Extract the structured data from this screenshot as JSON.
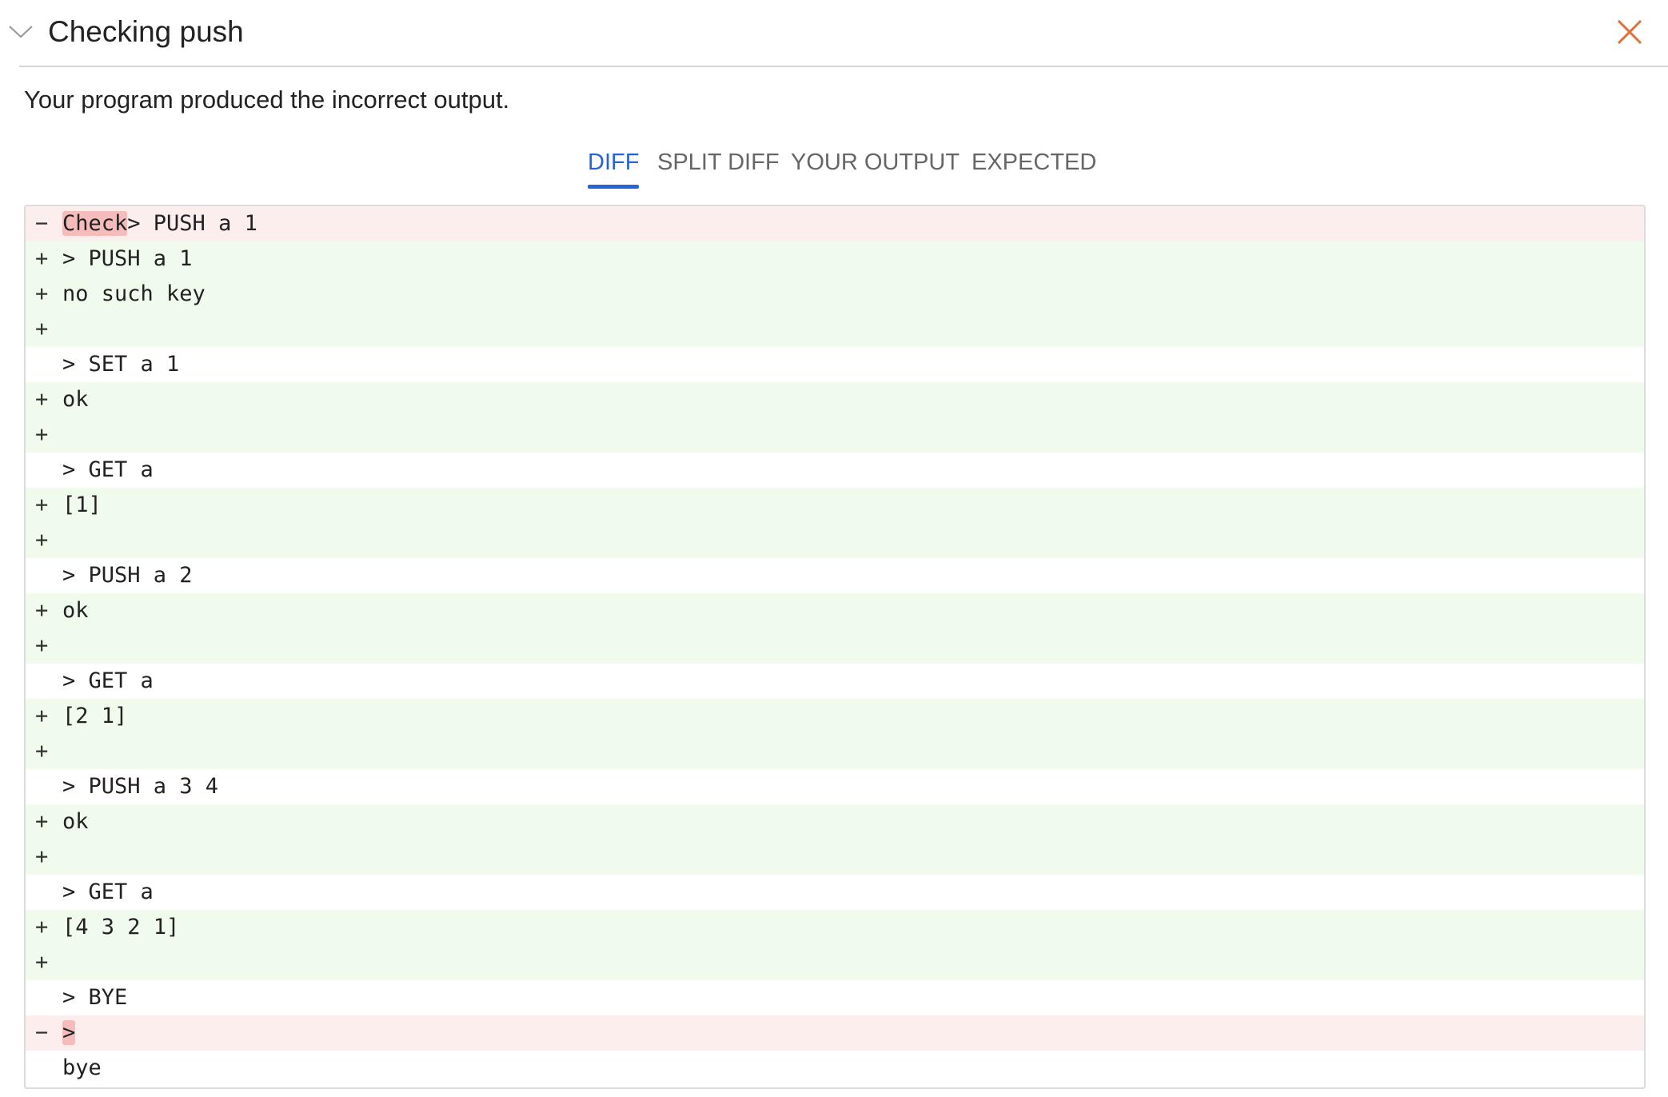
{
  "header": {
    "title": "Checking push"
  },
  "message": "Your program produced the incorrect output.",
  "tabs": [
    {
      "label": "DIFF",
      "active": true
    },
    {
      "label": "SPLIT DIFF",
      "active": false
    },
    {
      "label": "YOUR OUTPUT",
      "active": false
    },
    {
      "label": "EXPECTED",
      "active": false
    }
  ],
  "icons": {
    "collapse": "chevron-down-icon",
    "close": "close-icon"
  },
  "colors": {
    "accent": "#2563d6",
    "close": "#e0713a",
    "removed_bg": "#fdeeee",
    "removed_highlight": "#f6bcbc",
    "added_bg": "#f0fbee"
  },
  "diff": [
    {
      "kind": "removed",
      "marker": "−",
      "highlight": "Check",
      "text": "> PUSH a 1"
    },
    {
      "kind": "added",
      "marker": "+",
      "text": "> PUSH a 1"
    },
    {
      "kind": "added",
      "marker": "+",
      "text": "no such key"
    },
    {
      "kind": "added",
      "marker": "+",
      "text": ""
    },
    {
      "kind": "context",
      "marker": "",
      "text": "> SET a 1"
    },
    {
      "kind": "added",
      "marker": "+",
      "text": "ok"
    },
    {
      "kind": "added",
      "marker": "+",
      "text": ""
    },
    {
      "kind": "context",
      "marker": "",
      "text": "> GET a"
    },
    {
      "kind": "added",
      "marker": "+",
      "text": "[1]"
    },
    {
      "kind": "added",
      "marker": "+",
      "text": ""
    },
    {
      "kind": "context",
      "marker": "",
      "text": "> PUSH a 2"
    },
    {
      "kind": "added",
      "marker": "+",
      "text": "ok"
    },
    {
      "kind": "added",
      "marker": "+",
      "text": ""
    },
    {
      "kind": "context",
      "marker": "",
      "text": "> GET a"
    },
    {
      "kind": "added",
      "marker": "+",
      "text": "[2 1]"
    },
    {
      "kind": "added",
      "marker": "+",
      "text": ""
    },
    {
      "kind": "context",
      "marker": "",
      "text": "> PUSH a 3 4"
    },
    {
      "kind": "added",
      "marker": "+",
      "text": "ok"
    },
    {
      "kind": "added",
      "marker": "+",
      "text": ""
    },
    {
      "kind": "context",
      "marker": "",
      "text": "> GET a"
    },
    {
      "kind": "added",
      "marker": "+",
      "text": "[4 3 2 1]"
    },
    {
      "kind": "added",
      "marker": "+",
      "text": ""
    },
    {
      "kind": "context",
      "marker": "",
      "text": "> BYE"
    },
    {
      "kind": "removed",
      "marker": "−",
      "highlight": ">",
      "text": ""
    },
    {
      "kind": "context",
      "marker": "",
      "text": "bye"
    }
  ]
}
